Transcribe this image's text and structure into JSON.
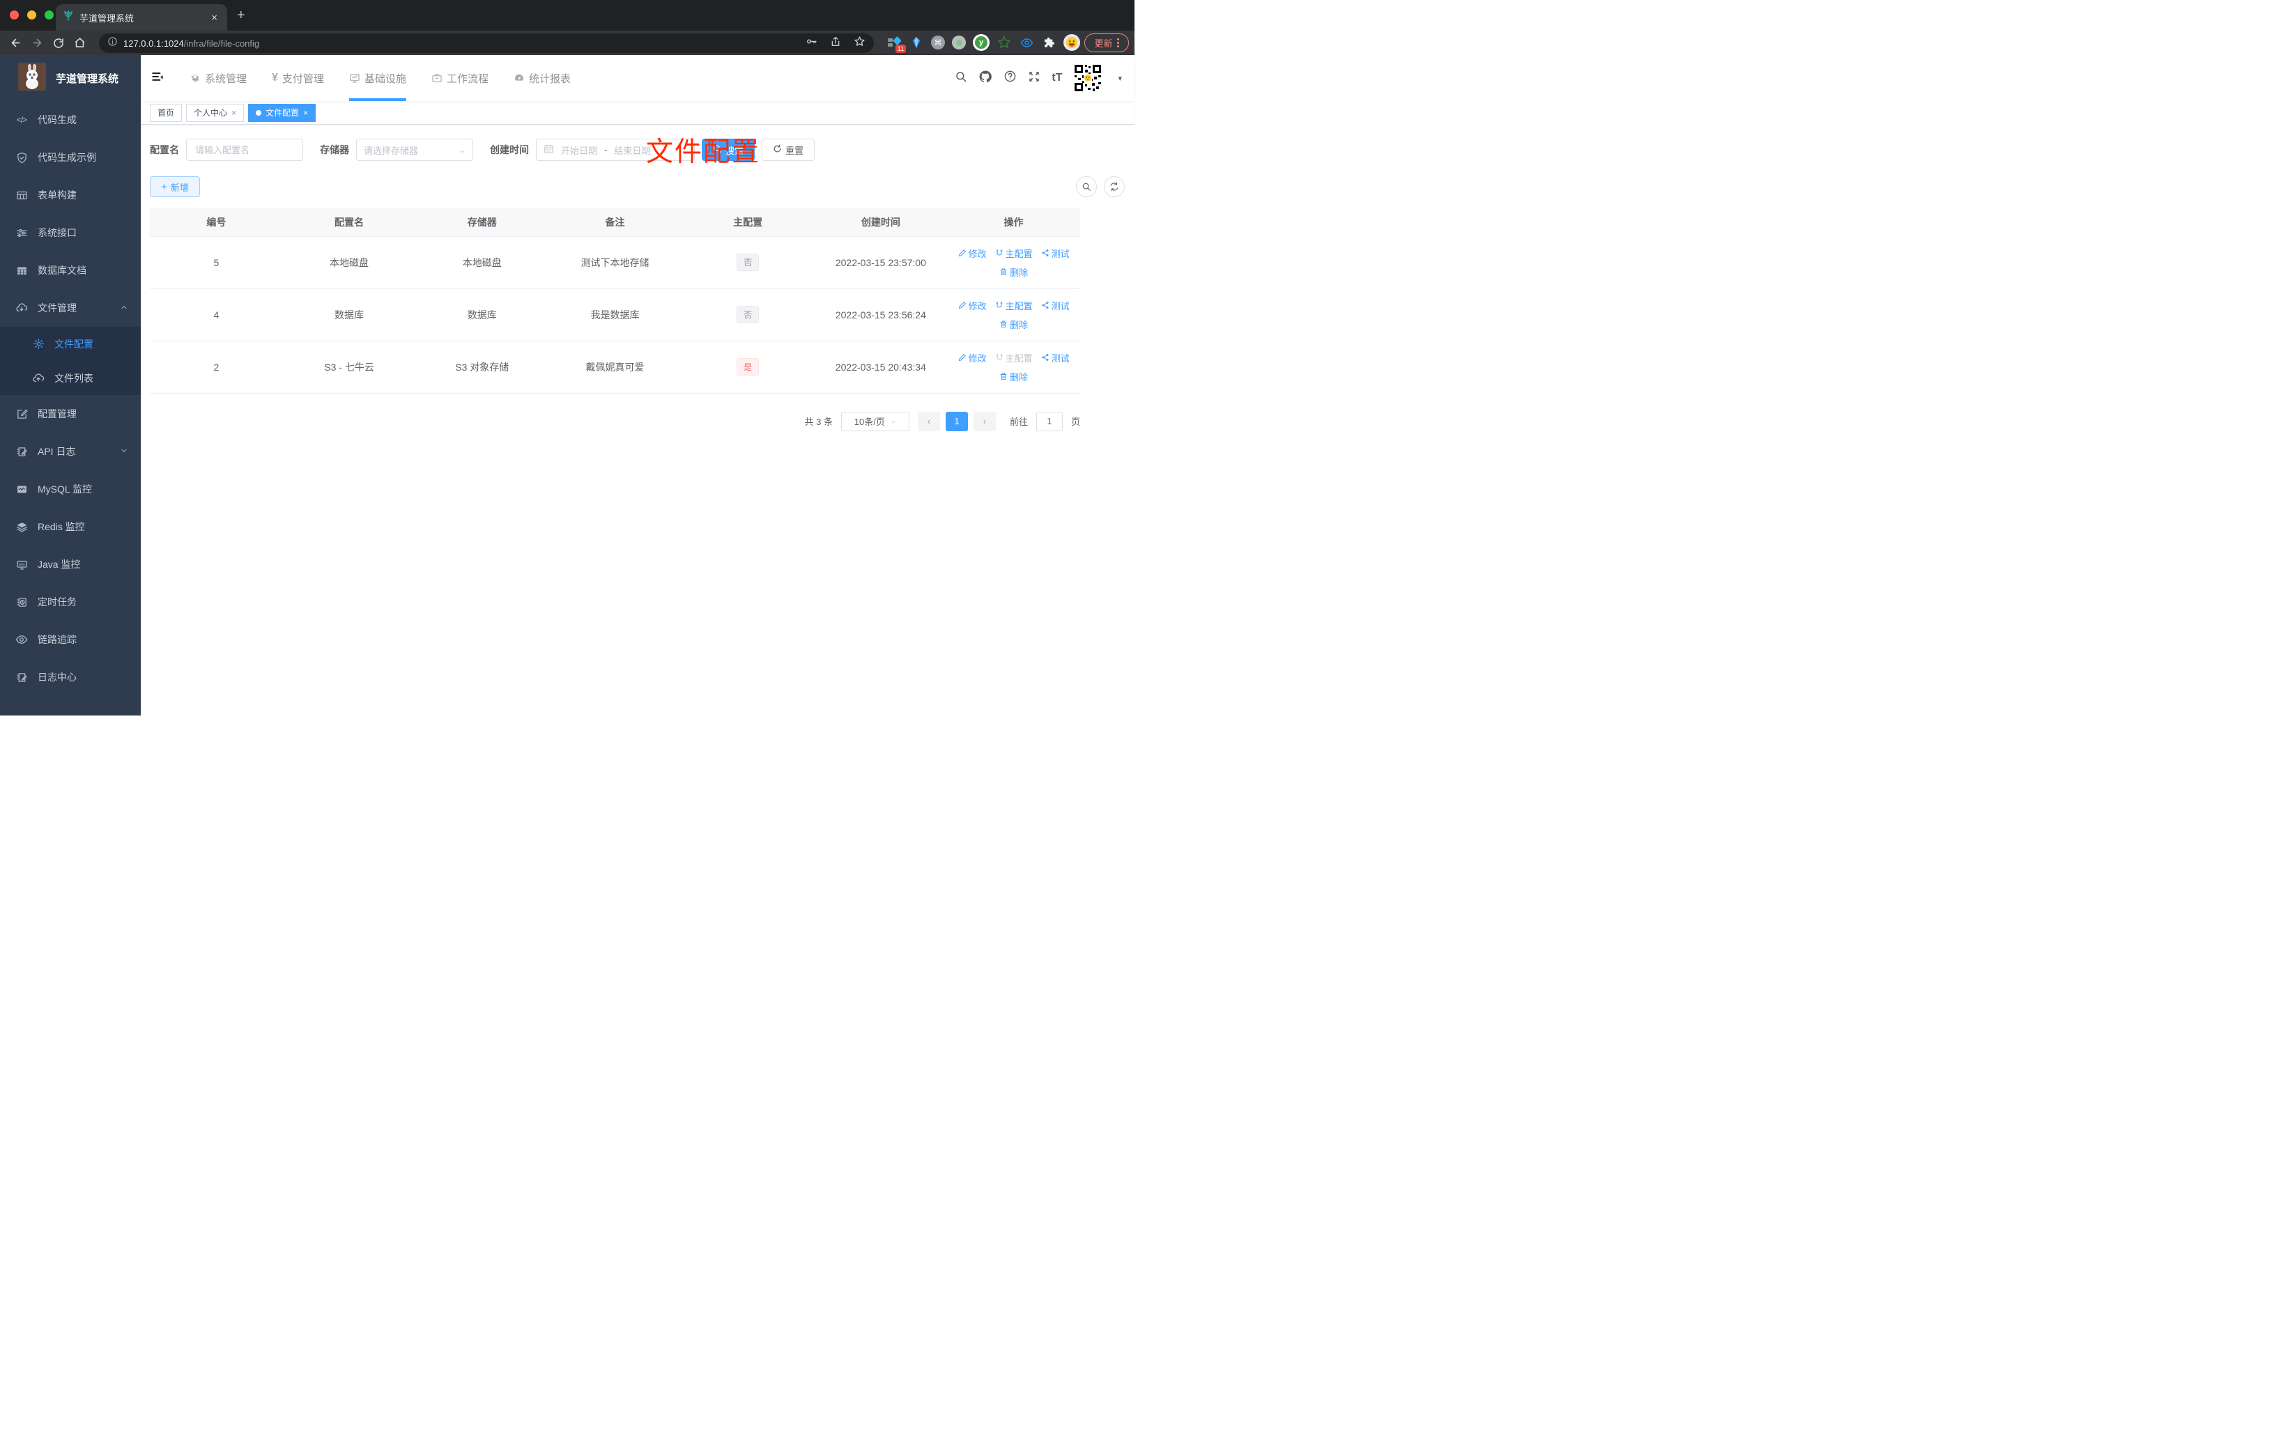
{
  "browser": {
    "tab_title": "芋道管理系统",
    "url_host": "127.0.0.1:1024",
    "url_path": "/infra/file/file-config",
    "extension_badge": "11",
    "update_label": "更新"
  },
  "icons": {
    "close": "×",
    "plus": "+",
    "newtab_plus": "+",
    "yen": "¥",
    "code": "</>",
    "font_size": "tT",
    "tab_dot": "",
    "caret_down": "▾",
    "select_caret": "⌄",
    "prev_arrow": "‹",
    "next_arrow": "›",
    "ext_cmd": "⌘",
    "ext_y": "y"
  },
  "sidebar": {
    "logo_title": "芋道管理系统",
    "items": [
      {
        "label": "代码生成"
      },
      {
        "label": "代码生成示例"
      },
      {
        "label": "表单构建"
      },
      {
        "label": "系统接口"
      },
      {
        "label": "数据库文档"
      },
      {
        "label": "文件管理"
      }
    ],
    "file_children": [
      {
        "label": "文件配置"
      },
      {
        "label": "文件列表"
      }
    ],
    "items_after": [
      {
        "label": "配置管理"
      },
      {
        "label": "API 日志"
      },
      {
        "label": "MySQL 监控"
      },
      {
        "label": "Redis 监控"
      },
      {
        "label": "Java 监控"
      },
      {
        "label": "定时任务"
      },
      {
        "label": "链路追踪"
      },
      {
        "label": "日志中心"
      }
    ]
  },
  "topnav": {
    "items": [
      {
        "label": "系统管理"
      },
      {
        "label": "支付管理"
      },
      {
        "label": "基础设施"
      },
      {
        "label": "工作流程"
      },
      {
        "label": "统计报表"
      }
    ]
  },
  "tags": [
    {
      "label": "首页"
    },
    {
      "label": "个人中心"
    },
    {
      "label": "文件配置"
    }
  ],
  "annotation": "文件配置",
  "filter": {
    "name_label": "配置名",
    "name_placeholder": "请输入配置名",
    "storage_label": "存储器",
    "storage_placeholder": "请选择存储器",
    "date_label": "创建时间",
    "date_start": "开始日期",
    "date_sep": "-",
    "date_end": "结束日期",
    "search_label": "搜索",
    "reset_label": "重置",
    "add_label": "新增"
  },
  "table": {
    "headers": [
      "编号",
      "配置名",
      "存储器",
      "备注",
      "主配置",
      "创建时间",
      "操作"
    ],
    "rows": [
      {
        "id": "5",
        "name": "本地磁盘",
        "storage": "本地磁盘",
        "remark": "测试下本地存储",
        "primary": "否",
        "created": "2022-03-15 23:57:00",
        "actions": {
          "edit": "修改",
          "primary": "主配置",
          "test": "测试",
          "del": "删除"
        }
      },
      {
        "id": "4",
        "name": "数据库",
        "storage": "数据库",
        "remark": "我是数据库",
        "primary": "否",
        "created": "2022-03-15 23:56:24",
        "actions": {
          "edit": "修改",
          "primary": "主配置",
          "test": "测试",
          "del": "删除"
        }
      },
      {
        "id": "2",
        "name": "S3 - 七牛云",
        "storage": "S3 对象存储",
        "remark": "戴佩妮真可爱",
        "primary": "是",
        "created": "2022-03-15 20:43:34",
        "actions": {
          "edit": "修改",
          "primary": "主配置",
          "test": "测试",
          "del": "删除"
        }
      }
    ]
  },
  "pagination": {
    "total": "共 3 条",
    "page_size": "10条/页",
    "current": "1",
    "goto_label": "前往",
    "goto_value": "1",
    "page_suffix": "页"
  }
}
